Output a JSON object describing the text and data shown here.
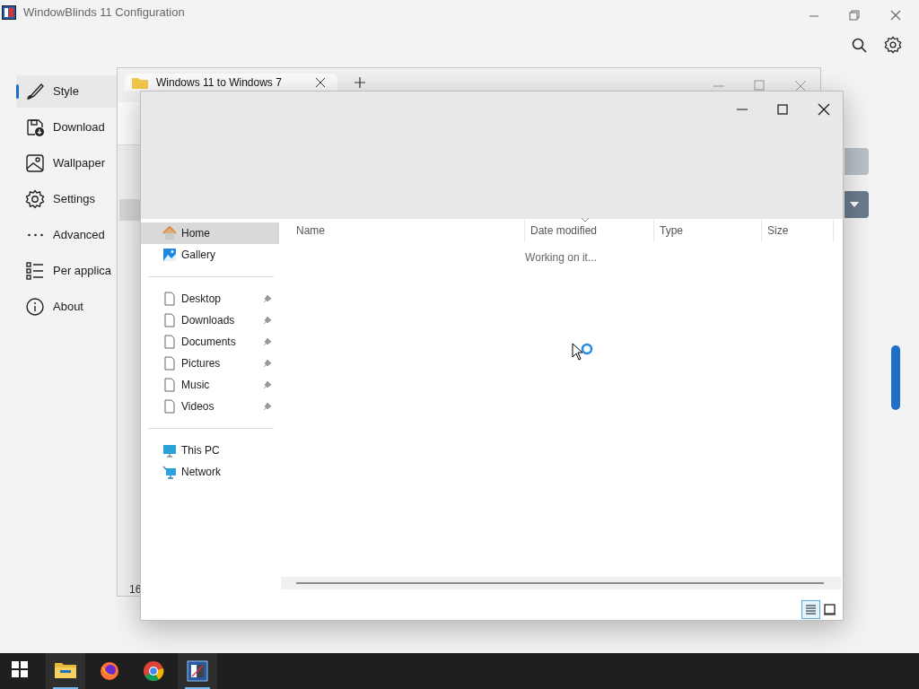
{
  "app": {
    "title": "WindowBlinds 11 Configuration",
    "nav": [
      {
        "label": "Style",
        "selected": true
      },
      {
        "label": "Download",
        "selected": false
      },
      {
        "label": "Wallpaper",
        "selected": false
      },
      {
        "label": "Settings",
        "selected": false
      },
      {
        "label": "Advanced",
        "selected": false
      },
      {
        "label": "Per applica",
        "selected": false
      },
      {
        "label": "About",
        "selected": false
      }
    ]
  },
  "back_window": {
    "tab": {
      "label": "Windows 11 to Windows 7"
    },
    "status_text": "16"
  },
  "explorer": {
    "nav_groups": [
      [
        {
          "label": "Home",
          "selected": true,
          "pinned": false
        },
        {
          "label": "Gallery",
          "selected": false,
          "pinned": false
        }
      ],
      [
        {
          "label": "Desktop",
          "selected": false,
          "pinned": true
        },
        {
          "label": "Downloads",
          "selected": false,
          "pinned": true
        },
        {
          "label": "Documents",
          "selected": false,
          "pinned": true
        },
        {
          "label": "Pictures",
          "selected": false,
          "pinned": true
        },
        {
          "label": "Music",
          "selected": false,
          "pinned": true
        },
        {
          "label": "Videos",
          "selected": false,
          "pinned": true
        }
      ],
      [
        {
          "label": "This PC",
          "selected": false,
          "pinned": false
        },
        {
          "label": "Network",
          "selected": false,
          "pinned": false
        }
      ]
    ],
    "columns": [
      {
        "label": "Name",
        "sorted": false
      },
      {
        "label": "Date modified",
        "sorted": true
      },
      {
        "label": "Type",
        "sorted": false
      },
      {
        "label": "Size",
        "sorted": false
      }
    ],
    "status_message": "Working on it...",
    "view_buttons": [
      {
        "kind": "details",
        "selected": true
      },
      {
        "kind": "tiles",
        "selected": false
      }
    ]
  },
  "taskbar": [
    {
      "kind": "start",
      "active": false
    },
    {
      "kind": "explorer",
      "active": true
    },
    {
      "kind": "firefox",
      "active": false
    },
    {
      "kind": "chrome",
      "active": false
    },
    {
      "kind": "windowblinds",
      "active": true
    }
  ]
}
